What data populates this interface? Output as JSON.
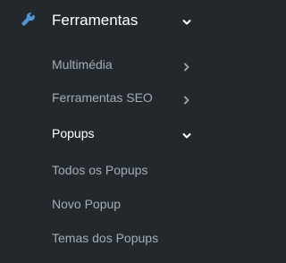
{
  "menu": {
    "parent": {
      "label": "Ferramentas",
      "icon": "wrench-icon",
      "expanded": true
    },
    "items": [
      {
        "label": "Multimédia",
        "has_submenu": true,
        "expanded": false
      },
      {
        "label": "Ferramentas SEO",
        "has_submenu": true,
        "expanded": false
      },
      {
        "label": "Popups",
        "has_submenu": true,
        "expanded": true
      },
      {
        "label": "Todos os Popups",
        "has_submenu": false
      },
      {
        "label": "Novo Popup",
        "has_submenu": false
      },
      {
        "label": "Temas dos Popups",
        "has_submenu": false
      }
    ]
  },
  "colors": {
    "background": "#23282d",
    "accent_icon": "#4f94d4",
    "text_active": "#ffffff",
    "text_muted": "#a3adb6"
  }
}
